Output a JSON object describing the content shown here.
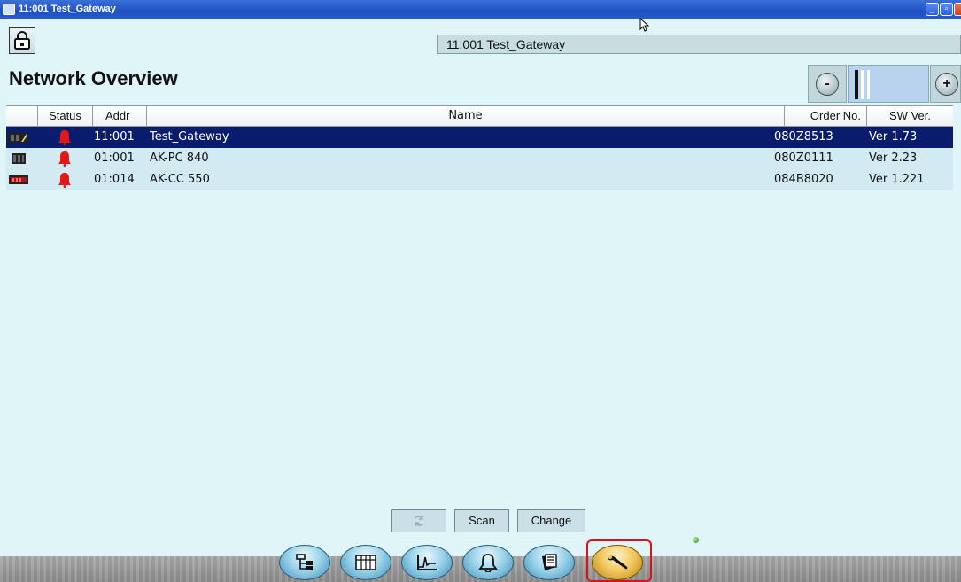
{
  "window": {
    "title": "11:001 Test_Gateway"
  },
  "header": {
    "gateway_field": "11:001 Test_Gateway",
    "lock_icon": "lock-icon"
  },
  "page": {
    "title": "Network Overview"
  },
  "zoom": {
    "minus_symbol": "-",
    "plus_symbol": "+"
  },
  "table": {
    "columns": [
      "Status",
      "Addr",
      "Name",
      "Order No.",
      "SW Ver."
    ],
    "rows": [
      {
        "icon": "gateway-device-icon",
        "status_icon": "alarm-bell-icon",
        "addr": "11:001",
        "name": "Test_Gateway",
        "order": "080Z8513",
        "ver": "Ver 1.73"
      },
      {
        "icon": "controller-device-icon",
        "status_icon": "alarm-bell-icon",
        "addr": "01:001",
        "name": "AK-PC 840",
        "order": "080Z0111",
        "ver": "Ver 2.23"
      },
      {
        "icon": "display-device-icon",
        "status_icon": "alarm-bell-icon",
        "addr": "01:014",
        "name": "AK-CC 550",
        "order": "084B8020",
        "ver": "Ver 1.221"
      }
    ],
    "selected_row": 0
  },
  "actions": {
    "refresh_icon": "refresh-icon",
    "scan": "Scan",
    "change": "Change"
  },
  "nav": {
    "items": [
      "network-tree-icon",
      "grid-view-icon",
      "trend-graph-icon",
      "alarm-bell-icon",
      "notes-icon",
      "service-wrench-icon"
    ],
    "active": "service-wrench-icon"
  },
  "colors": {
    "background": "#dff5f8",
    "selected_row": "#0a1c6e",
    "alarm": "#e01818",
    "highlight": "#d9121b"
  }
}
